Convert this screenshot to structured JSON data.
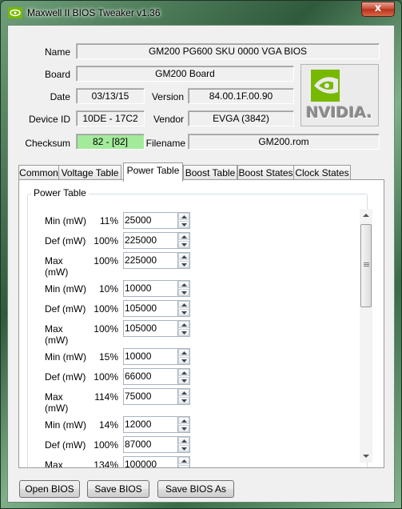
{
  "window": {
    "title": "Maxwell II BIOS Tweaker v1.36",
    "close_glyph": "x"
  },
  "info": {
    "name_label": "Name",
    "name_value": "GM200 PG600 SKU 0000 VGA BIOS",
    "board_label": "Board",
    "board_value": "GM200 Board",
    "date_label": "Date",
    "date_value": "03/13/15",
    "version_label": "Version",
    "version_value": "84.00.1F.00.90",
    "device_id_label": "Device ID",
    "device_id_value": "10DE - 17C2",
    "vendor_label": "Vendor",
    "vendor_value": "EVGA (3842)",
    "checksum_label": "Checksum",
    "checksum_value": "82 - [82]",
    "filename_label": "Filename",
    "filename_value": "GM200.rom",
    "checksum_color": "#a3ea9b",
    "logo_text": "NVIDIA."
  },
  "tabs": [
    "Common",
    "Voltage Table",
    "Power Table",
    "Boost Table",
    "Boost States",
    "Clock States"
  ],
  "active_tab": "Power Table",
  "power_table": {
    "title": "Power Table",
    "rows": [
      {
        "label": "Min (mW)",
        "pct": "11%",
        "value": "25000"
      },
      {
        "label": "Def (mW)",
        "pct": "100%",
        "value": "225000"
      },
      {
        "label": "Max (mW)",
        "pct": "100%",
        "value": "225000"
      },
      {
        "label": "Min (mW)",
        "pct": "10%",
        "value": "10000"
      },
      {
        "label": "Def (mW)",
        "pct": "100%",
        "value": "105000"
      },
      {
        "label": "Max (mW)",
        "pct": "100%",
        "value": "105000"
      },
      {
        "label": "Min (mW)",
        "pct": "15%",
        "value": "10000"
      },
      {
        "label": "Def (mW)",
        "pct": "100%",
        "value": "66000"
      },
      {
        "label": "Max (mW)",
        "pct": "114%",
        "value": "75000"
      },
      {
        "label": "Min (mW)",
        "pct": "14%",
        "value": "12000"
      },
      {
        "label": "Def (mW)",
        "pct": "100%",
        "value": "87000"
      },
      {
        "label": "Max (mW)",
        "pct": "134%",
        "value": "100000"
      }
    ]
  },
  "buttons": {
    "open": "Open BIOS",
    "save": "Save BIOS",
    "save_as": "Save BIOS As"
  },
  "colors": {
    "accent_nvidia": "#76b900"
  }
}
